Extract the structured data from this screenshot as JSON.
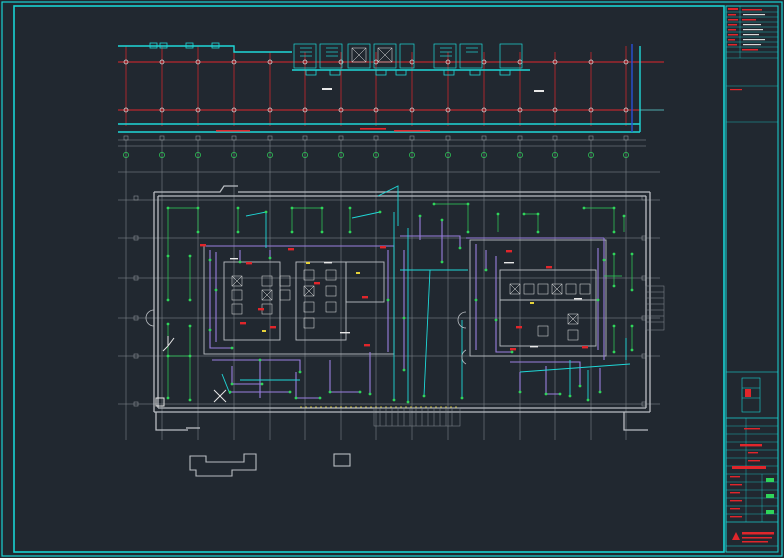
{
  "colors": {
    "background": "#212830",
    "frame": "#19d3d3",
    "structure_grid": "#8a8f96",
    "walls": "#b9bdc2",
    "pipe_red": "#e0262b",
    "conduit_cyan": "#1fd7d7",
    "duct_purple": "#9a7fe0",
    "device_green": "#2fd45a",
    "accent_yellow": "#e6d23a",
    "accent_blue": "#2a4fd6",
    "accent_white": "#e8e8e8"
  },
  "icons": {
    "compass": "north-arrow-icon",
    "cross_marker": "x-marker-icon",
    "legend_box": "legend-square-icon"
  }
}
